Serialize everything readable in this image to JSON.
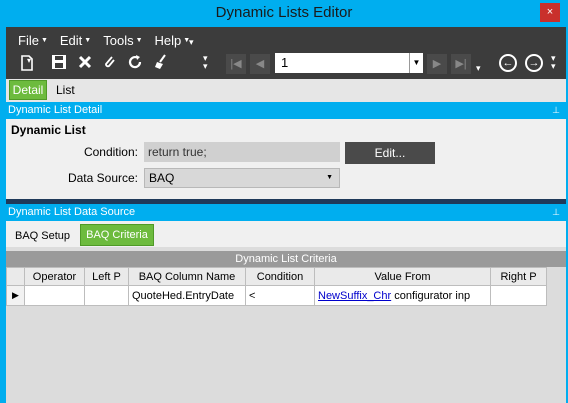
{
  "window": {
    "title": "Dynamic Lists Editor",
    "close_glyph": "×"
  },
  "menu": [
    {
      "label": "File"
    },
    {
      "label": "Edit"
    },
    {
      "label": "Tools"
    },
    {
      "label": "Help"
    }
  ],
  "navigator": {
    "current_record": "1"
  },
  "tabs": [
    {
      "label": "Detail",
      "active": true
    },
    {
      "label": "List",
      "active": false
    }
  ],
  "detail_section": {
    "header": "Dynamic List Detail",
    "group_label": "Dynamic List",
    "condition_label": "Condition:",
    "condition_value": "return true;",
    "edit_button": "Edit...",
    "data_source_label": "Data Source:",
    "data_source_value": "BAQ"
  },
  "datasource_section": {
    "header": "Dynamic List Data Source",
    "subtabs": [
      {
        "label": "BAQ Setup",
        "active": false
      },
      {
        "label": "BAQ Criteria",
        "active": true
      }
    ],
    "grid_caption": "Dynamic List Criteria",
    "columns": [
      "Operator",
      "Left P",
      "BAQ Column Name",
      "Condition",
      "Value From",
      "Right P"
    ],
    "rows": [
      {
        "operator": "",
        "left_p": "",
        "baq_column": "QuoteHed.EntryDate",
        "condition": "<",
        "value_link": "NewSuffix_Chr",
        "value_text": "configurator inp",
        "right_p": ""
      }
    ]
  },
  "colors": {
    "accent": "#00aeef",
    "active_tab": "#6dbb3e",
    "toolbar": "#3c3c3c",
    "close_button": "#c9302c"
  }
}
